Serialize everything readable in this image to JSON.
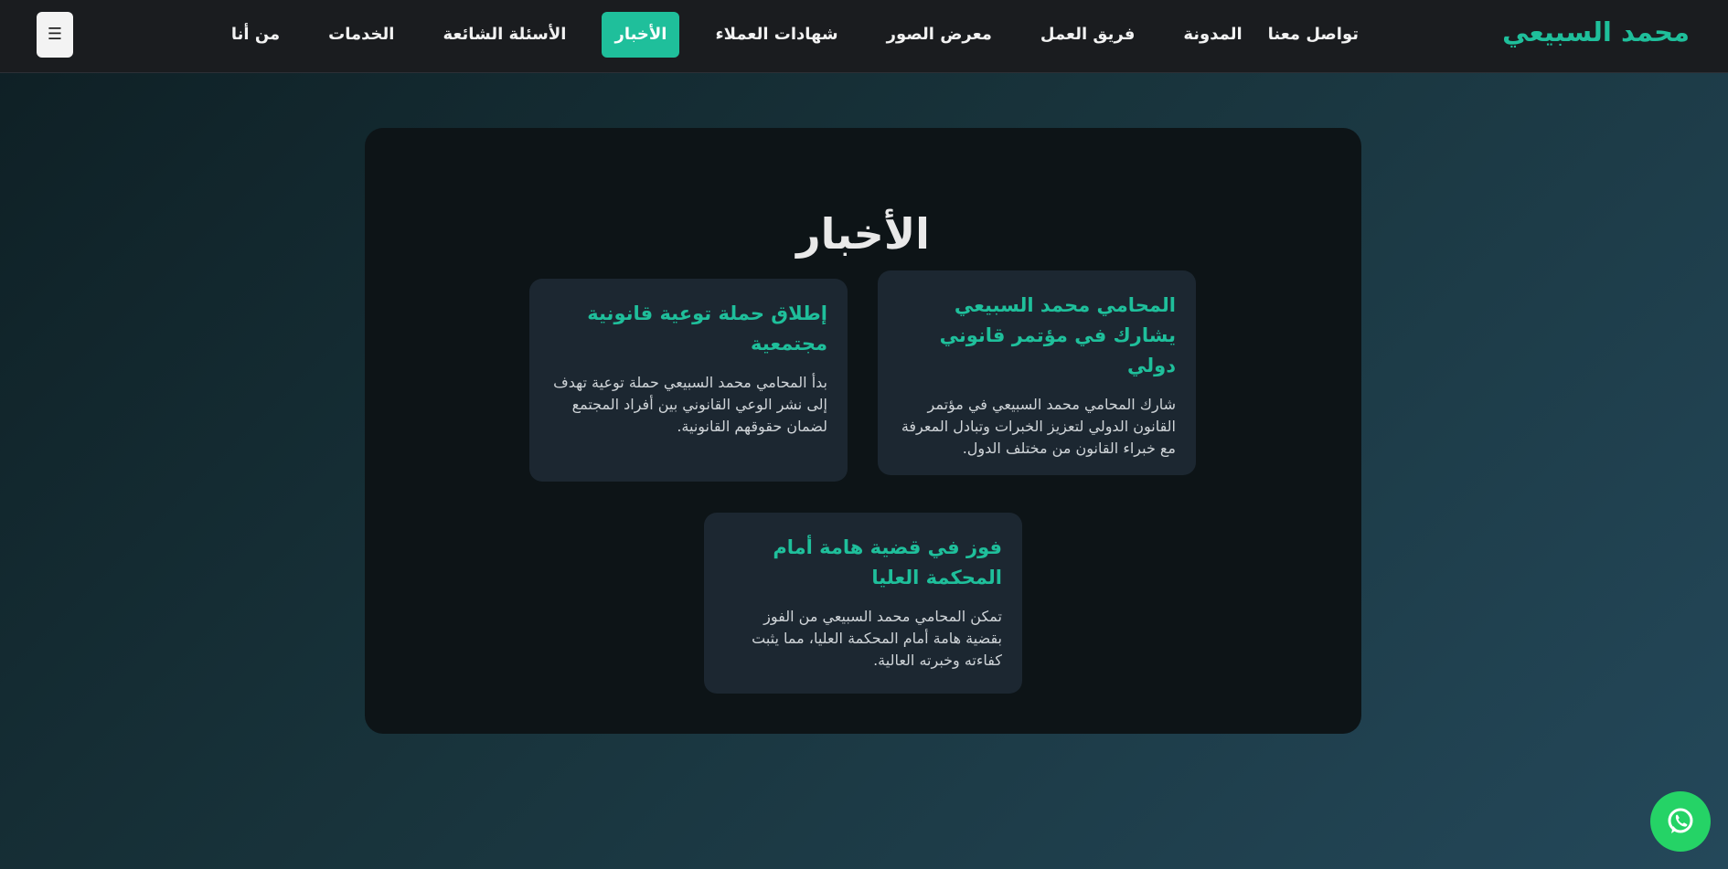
{
  "header": {
    "brand": "محمد السبيعي",
    "menu_icon": "hamburger-icon",
    "menu_glyph": "☰",
    "nav": [
      {
        "label": "من أنا",
        "active": false
      },
      {
        "label": "الخدمات",
        "active": false
      },
      {
        "label": "الأسئلة الشائعة",
        "active": false
      },
      {
        "label": "الأخبار",
        "active": true
      },
      {
        "label": "شهادات العملاء",
        "active": false
      },
      {
        "label": "معرض الصور",
        "active": false
      },
      {
        "label": "فريق العمل",
        "active": false
      },
      {
        "label": "المدونة",
        "active": false
      },
      {
        "label": "تواصل معنا",
        "active": false
      }
    ]
  },
  "news": {
    "title": "الأخبار",
    "items": [
      {
        "title": "المحامي محمد السبيعي يشارك في مؤتمر قانوني دولي",
        "body": "شارك المحامي محمد السبيعي في مؤتمر القانون الدولي لتعزيز الخبرات وتبادل المعرفة مع خبراء القانون من مختلف الدول."
      },
      {
        "title": "إطلاق حملة توعية قانونية مجتمعية",
        "body": "بدأ المحامي محمد السبيعي حملة توعية تهدف إلى نشر الوعي القانوني بين أفراد المجتمع لضمان حقوقهم القانونية."
      },
      {
        "title": "فوز في قضية هامة أمام المحكمة العليا",
        "body": "تمكن المحامي محمد السبيعي من الفوز بقضية هامة أمام المحكمة العليا، مما يثبت كفاءته وخبرته العالية."
      }
    ]
  },
  "floating": {
    "icon": "whatsapp-icon"
  },
  "colors": {
    "accent": "#1fbf9b",
    "navbar_bg": "#1a1c1f",
    "panel_bg": "#0d1417",
    "card_bg": "#1c2731",
    "whatsapp": "#25d366"
  }
}
